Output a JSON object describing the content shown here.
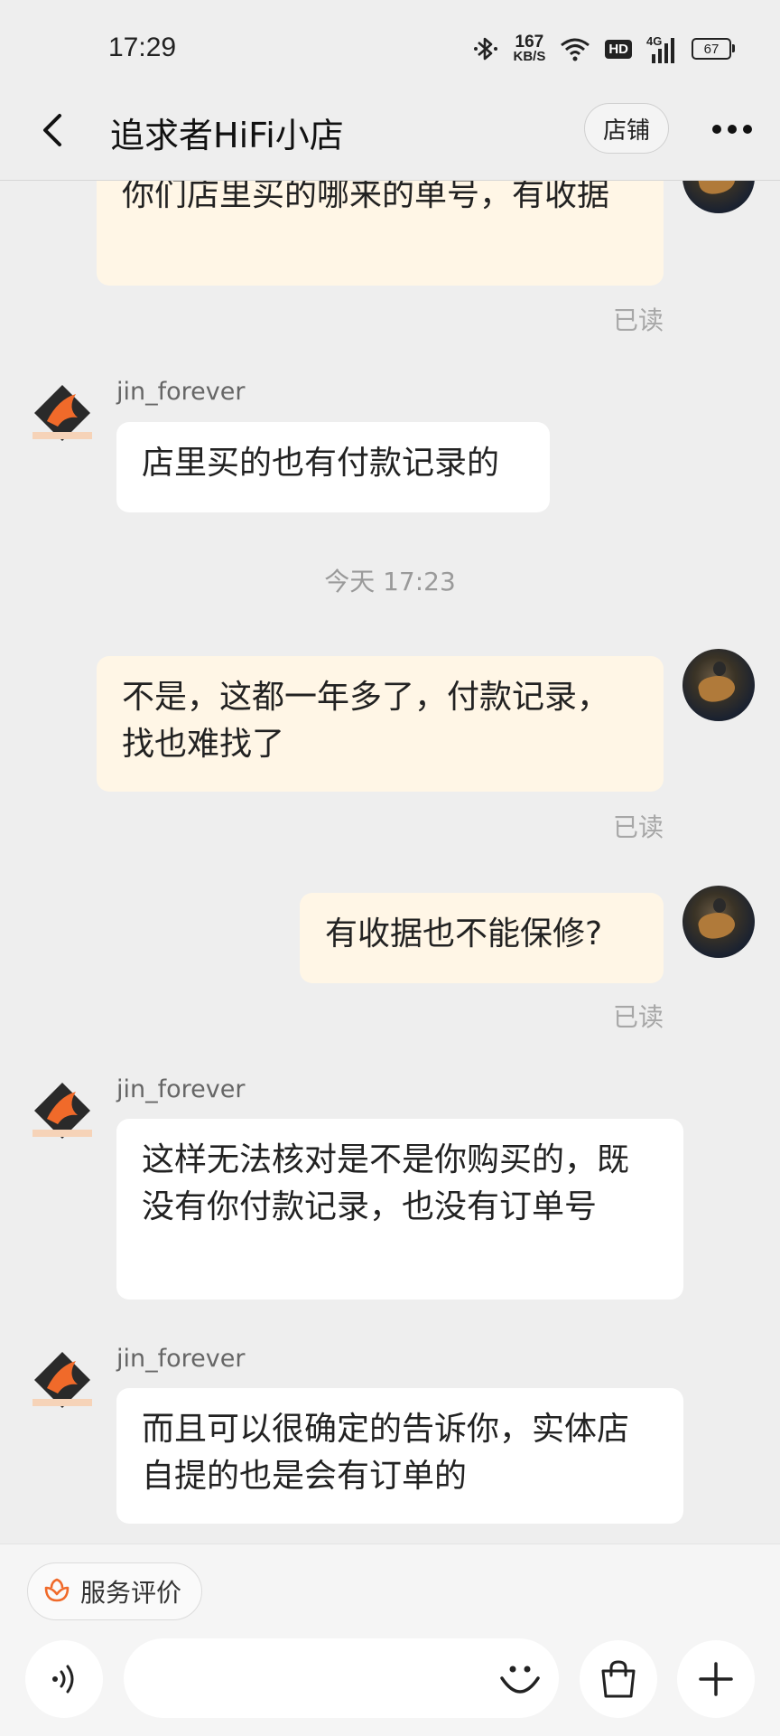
{
  "status_bar": {
    "time": "17:29",
    "net_speed_value": "167",
    "net_speed_unit": "KB/S",
    "hd": "HD",
    "signal": "4G",
    "battery": "67"
  },
  "header": {
    "title": "追求者HiFi小店",
    "shop_button": "店铺"
  },
  "messages": {
    "m1": {
      "text": "你们店里买的哪来的单号，有收据",
      "status": "已读"
    },
    "m2": {
      "sender": "jin_forever",
      "text": "店里买的也有付款记录的"
    },
    "timestamp": "今天  17:23",
    "m3": {
      "text": "不是，这都一年多了，付款记录，找也难找了",
      "status": "已读"
    },
    "m4": {
      "text": "有收据也不能保修?",
      "status": "已读"
    },
    "m5": {
      "sender": "jin_forever",
      "text": "这样无法核对是不是你购买的，既没有你付款记录，也没有订单号"
    },
    "m6": {
      "sender": "jin_forever",
      "text": "而且可以很确定的告诉你，实体店自提的也是会有订单的"
    }
  },
  "bottom_bar": {
    "service_rating": "服务评价",
    "input_placeholder": ""
  },
  "colors": {
    "outgoing_bubble": "#fff6e6",
    "incoming_bubble": "#ffffff",
    "background": "#eeeeee",
    "accent_orange": "#f06a2a"
  },
  "icons": [
    "back-arrow-icon",
    "more-dots-icon",
    "voice-icon",
    "emoji-icon",
    "bag-icon",
    "plus-icon",
    "flower-icon",
    "bluetooth-icon",
    "wifi-icon",
    "signal-icon",
    "battery-icon"
  ]
}
